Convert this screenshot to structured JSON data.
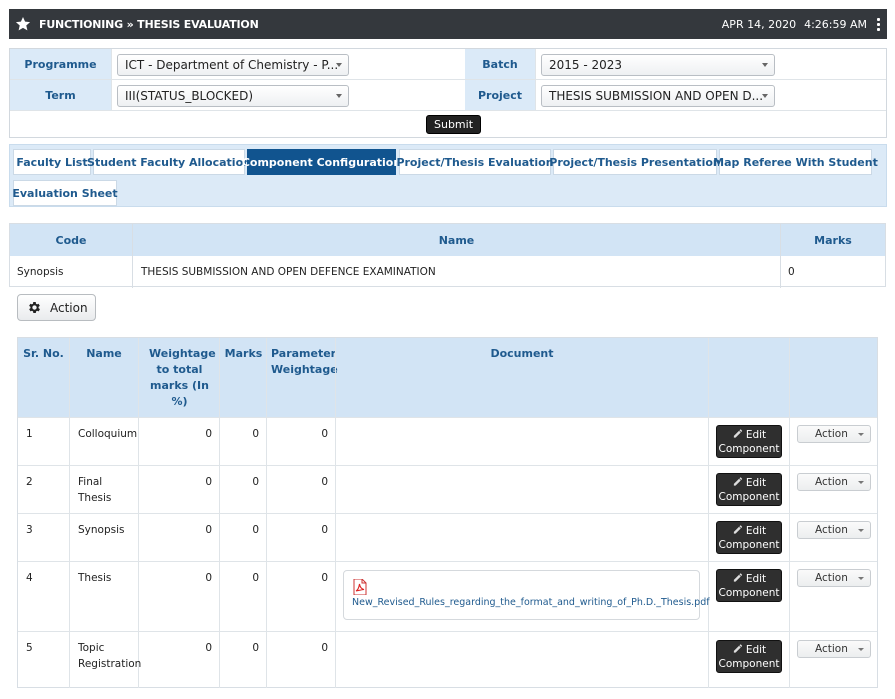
{
  "header": {
    "title": "FUNCTIONING » THESIS EVALUATION",
    "date": "APR 14, 2020",
    "time": "4:26:59 AM"
  },
  "filters": {
    "programme_label": "Programme",
    "programme_value": "ICT - Department of Chemistry - P...",
    "batch_label": "Batch",
    "batch_value": "2015 - 2023",
    "term_label": "Term",
    "term_value": "III(STATUS_BLOCKED)",
    "project_label": "Project",
    "project_value": "THESIS SUBMISSION AND OPEN D...",
    "submit_label": "Submit"
  },
  "tabs": [
    {
      "label": "Faculty List"
    },
    {
      "label": "Student Faculty Allocation"
    },
    {
      "label": "Component Configuration",
      "active": true
    },
    {
      "label": "Project/Thesis Evaluation"
    },
    {
      "label": "Project/Thesis Presentation"
    },
    {
      "label": "Map Referee With Student"
    },
    {
      "label": "Evaluation Sheet"
    }
  ],
  "component_table": {
    "headers": {
      "code": "Code",
      "name": "Name",
      "marks": "Marks"
    },
    "row": {
      "code": "Synopsis",
      "name": "THESIS SUBMISSION AND OPEN DEFENCE EXAMINATION",
      "marks": "0"
    }
  },
  "action_button_label": "Action",
  "detail_table": {
    "headers": {
      "sr_no": "Sr. No.",
      "name": "Name",
      "weightage": "Weightage to total marks (In %)",
      "marks": "Marks",
      "param_weightage": "Parameter Weightage",
      "document": "Document"
    },
    "edit_label_1": "Edit",
    "edit_label_2": "Component",
    "action_label": "Action",
    "rows": [
      {
        "sr": "1",
        "name": "Colloquium",
        "weightage": "0",
        "marks": "0",
        "param": "0",
        "document": ""
      },
      {
        "sr": "2",
        "name": "Final Thesis",
        "weightage": "0",
        "marks": "0",
        "param": "0",
        "document": ""
      },
      {
        "sr": "3",
        "name": "Synopsis",
        "weightage": "0",
        "marks": "0",
        "param": "0",
        "document": ""
      },
      {
        "sr": "4",
        "name": "Thesis",
        "weightage": "0",
        "marks": "0",
        "param": "0",
        "document": "New_Revised_Rules_regarding_the_format_and_writing_of_Ph.D._Thesis.pdf"
      },
      {
        "sr": "5",
        "name": "Topic Registration",
        "weightage": "0",
        "marks": "0",
        "param": "0",
        "document": ""
      }
    ]
  },
  "colors": {
    "header_bg": "#34383d",
    "label_bg": "#dbeaf8",
    "label_text": "#1f5a8e",
    "active_tab": "#11548f",
    "dark_button": "#2f2f2f"
  },
  "icons": [
    "star-icon",
    "kebab-menu-icon",
    "caret-down-icon",
    "gear-icon",
    "pencil-icon",
    "pdf-file-icon"
  ]
}
